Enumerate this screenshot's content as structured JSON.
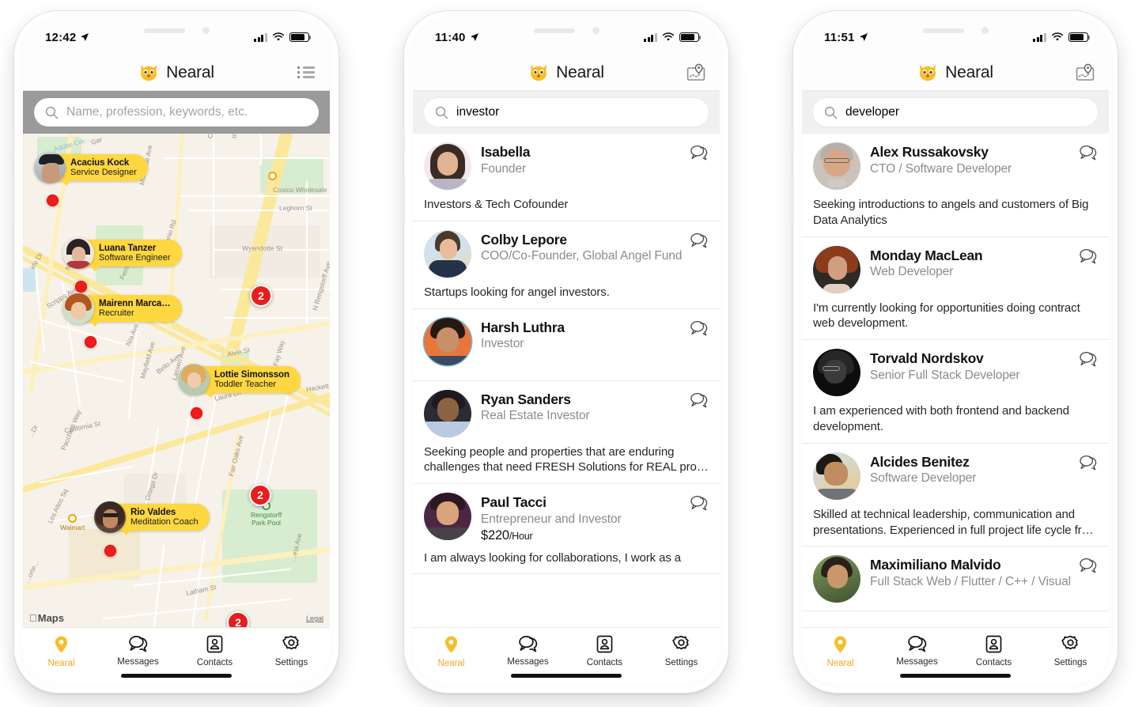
{
  "app": {
    "name": "Nearal",
    "accent": "#F5A623",
    "pin_yellow": "#FFD740",
    "cluster_red": "#E81D1D"
  },
  "tabs": [
    {
      "label": "Nearal",
      "icon": "map-pin-icon"
    },
    {
      "label": "Messages",
      "icon": "chat-bubbles-icon"
    },
    {
      "label": "Contacts",
      "icon": "contact-card-icon"
    },
    {
      "label": "Settings",
      "icon": "gear-icon"
    }
  ],
  "phones": [
    {
      "id": "phone-map",
      "status": {
        "time": "12:42",
        "location_arrow": true,
        "signal": "4-bars",
        "wifi": "wifi-icon",
        "battery": "battery-icon"
      },
      "nav": {
        "title": "Nearal",
        "right_icon": "list-icon"
      },
      "search": {
        "value": "",
        "placeholder": "Name, profession, keywords, etc."
      },
      "map": {
        "attribution": "Maps",
        "legal": "Legal",
        "street_labels": [
          "Adobe Creek",
          "Gar",
          "Commercial St",
          "Industrial",
          "Costco Wholesale",
          "Leghorn St",
          "Montrose Ave",
          "Middlefield Rd",
          "Wyandotte St",
          "Nelson Dr",
          "Ferne Ave",
          "San Antonio Rd",
          "Scripps Ave",
          "Alvin St",
          "N Rengstorff Ave",
          "N/a Ave",
          "Bello Ave",
          "Mayfield Ave",
          "Lassen Ave",
          "Laura Ln",
          "Fay Way",
          "California St",
          "Pacchetti Way",
          "Walmart",
          "Fair Oaks Ave",
          "Ortega Dr",
          "Rengstorff Park Pool",
          "Hackett Ave",
          "Los Altos Sq",
          "Latham St",
          "Marietta Ave",
          "ide Dr",
          "Porter Dr"
        ],
        "callouts": [
          {
            "name": "Acacius Kock",
            "role": "Service Designer",
            "avatar": "avatar-acacius"
          },
          {
            "name": "Luana Tanzer",
            "role": "Software Engineer",
            "avatar": "avatar-luana"
          },
          {
            "name": "Mairenn Marca…",
            "role": "Recruiter",
            "avatar": "avatar-mairenn"
          },
          {
            "name": "Lottie Simonsson",
            "role": "Toddler Teacher",
            "avatar": "avatar-lottie"
          },
          {
            "name": "Rio Valdes",
            "role": "Meditation  Coach",
            "avatar": "avatar-rio"
          }
        ],
        "clusters": [
          "2",
          "2",
          "2"
        ]
      },
      "active_tab": 0
    },
    {
      "id": "phone-investor",
      "status": {
        "time": "11:40",
        "location_arrow": true,
        "signal": "4-bars",
        "wifi": "wifi-icon",
        "battery": "battery-icon"
      },
      "nav": {
        "title": "Nearal",
        "right_icon": "map-photo-icon"
      },
      "search": {
        "value": "investor",
        "placeholder": "Name, profession, keywords, etc."
      },
      "results": [
        {
          "name": "Isabella",
          "role": "Founder",
          "price": "",
          "blurb": "Investors & Tech Cofounder",
          "avatar": "avatar-isabella"
        },
        {
          "name": "Colby Lepore",
          "role": "COO/Co-Founder, Global Angel Fund",
          "price": "",
          "blurb": "Startups looking for angel investors.",
          "avatar": "avatar-colby"
        },
        {
          "name": "Harsh Luthra",
          "role": "Investor",
          "price": "",
          "blurb": "",
          "avatar": "avatar-harsh"
        },
        {
          "name": "Ryan Sanders",
          "role": "Real Estate Investor",
          "price": "",
          "blurb": "Seeking people and properties that are enduring challenges that need FRESH Solutions for REAL pro…",
          "avatar": "avatar-ryan"
        },
        {
          "name": "Paul Tacci",
          "role": "Entrepreneur and Investor",
          "price": "$220",
          "price_unit": "/Hour",
          "blurb": "I am always looking for collaborations, I work as a",
          "avatar": "avatar-paul"
        }
      ],
      "active_tab": 0
    },
    {
      "id": "phone-developer",
      "status": {
        "time": "11:51",
        "location_arrow": true,
        "signal": "4-bars",
        "wifi": "wifi-icon",
        "battery": "battery-icon"
      },
      "nav": {
        "title": "Nearal",
        "right_icon": "map-photo-icon"
      },
      "search": {
        "value": "developer",
        "placeholder": "Name, profession, keywords, etc."
      },
      "results": [
        {
          "name": "Alex Russakovsky",
          "role": "CTO / Software Developer",
          "price": "",
          "blurb": "Seeking introductions to angels and customers of Big Data Analytics",
          "avatar": "avatar-alex"
        },
        {
          "name": "Monday MacLean",
          "role": "Web Developer",
          "price": "",
          "blurb": "I'm currently looking for opportunities doing contract web development.",
          "avatar": "avatar-monday"
        },
        {
          "name": "Torvald Nordskov",
          "role": "Senior Full Stack Developer",
          "price": "",
          "blurb": "I am experienced with both frontend and backend development.",
          "avatar": "avatar-torvald"
        },
        {
          "name": "Alcides Benitez",
          "role": "Software Developer",
          "price": "",
          "blurb": "Skilled at technical leadership, communication and presentations. Experienced in full project life cycle fr…",
          "avatar": "avatar-alcides"
        },
        {
          "name": "Maximiliano Malvido",
          "role": "Full Stack Web / Flutter / C++ / Visual",
          "price": "",
          "blurb": "",
          "avatar": "avatar-maximiliano"
        }
      ],
      "active_tab": 0
    }
  ]
}
